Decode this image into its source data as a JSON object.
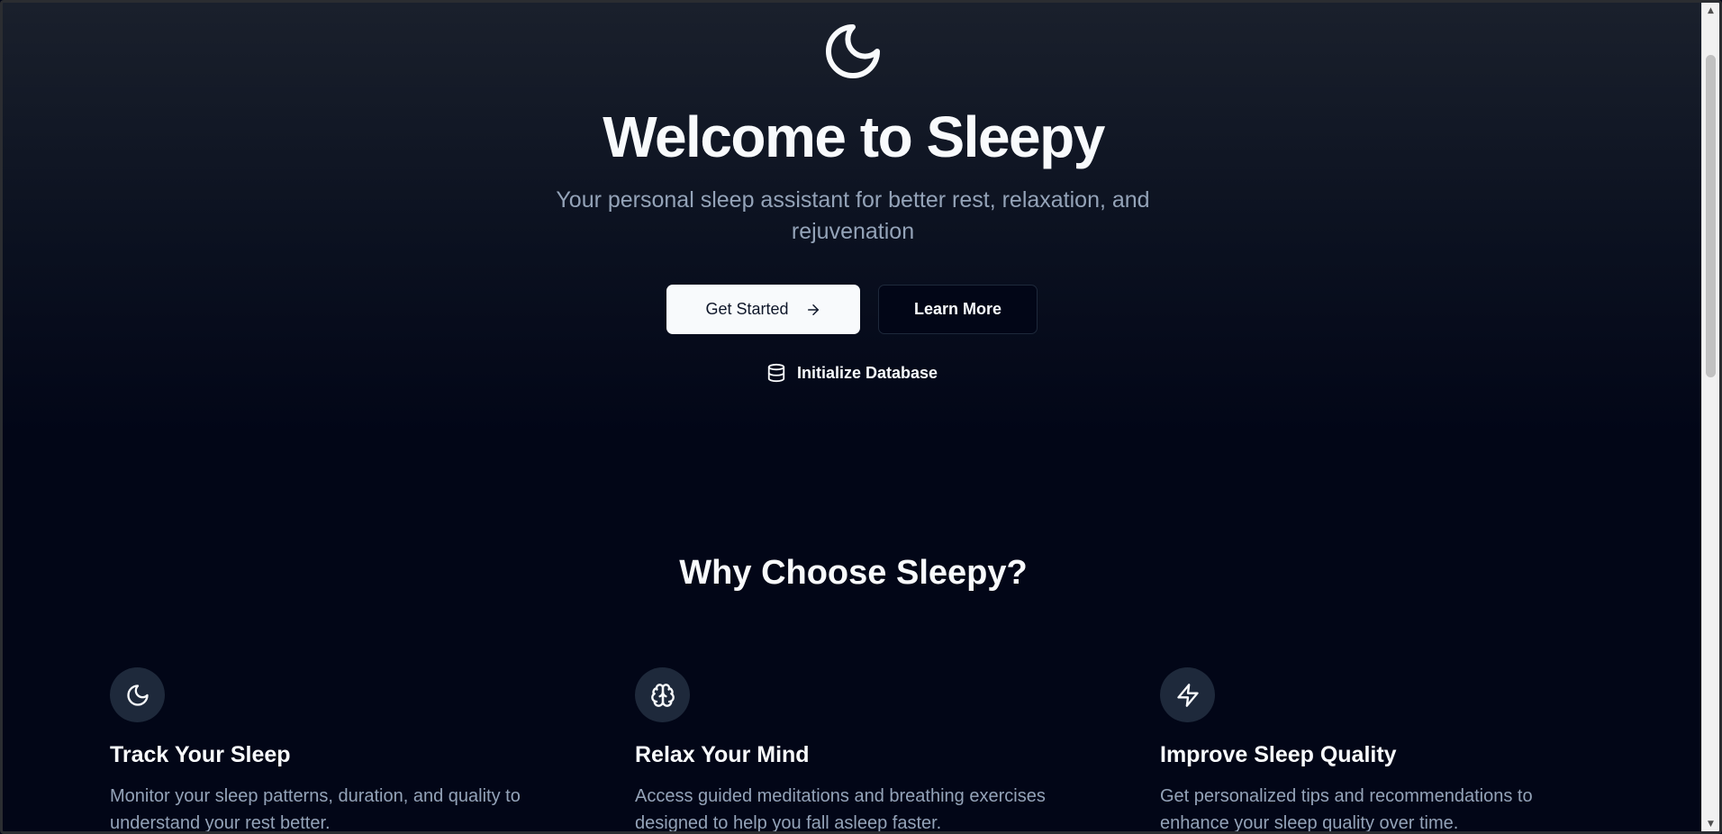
{
  "hero": {
    "logo_icon": "moon-icon",
    "title": "Welcome to Sleepy",
    "subtitle": "Your personal sleep assistant for better rest, relaxation, and rejuvenation",
    "primary_button": {
      "label": "Get Started",
      "icon": "arrow-right-icon"
    },
    "secondary_button": {
      "label": "Learn More"
    },
    "init_db": {
      "label": "Initialize Database",
      "icon": "database-icon"
    }
  },
  "features": {
    "title": "Why Choose Sleepy?",
    "items": [
      {
        "icon": "moon-icon",
        "title": "Track Your Sleep",
        "description": "Monitor your sleep patterns, duration, and quality to understand your rest better."
      },
      {
        "icon": "brain-icon",
        "title": "Relax Your Mind",
        "description": "Access guided meditations and breathing exercises designed to help you fall asleep faster."
      },
      {
        "icon": "zap-icon",
        "title": "Improve Sleep Quality",
        "description": "Get personalized tips and recommendations to enhance your sleep quality over time."
      }
    ]
  },
  "colors": {
    "background": "#020617",
    "foreground": "#f8fafc",
    "muted_text": "#94a3b8",
    "icon_circle": "#1e293b"
  }
}
